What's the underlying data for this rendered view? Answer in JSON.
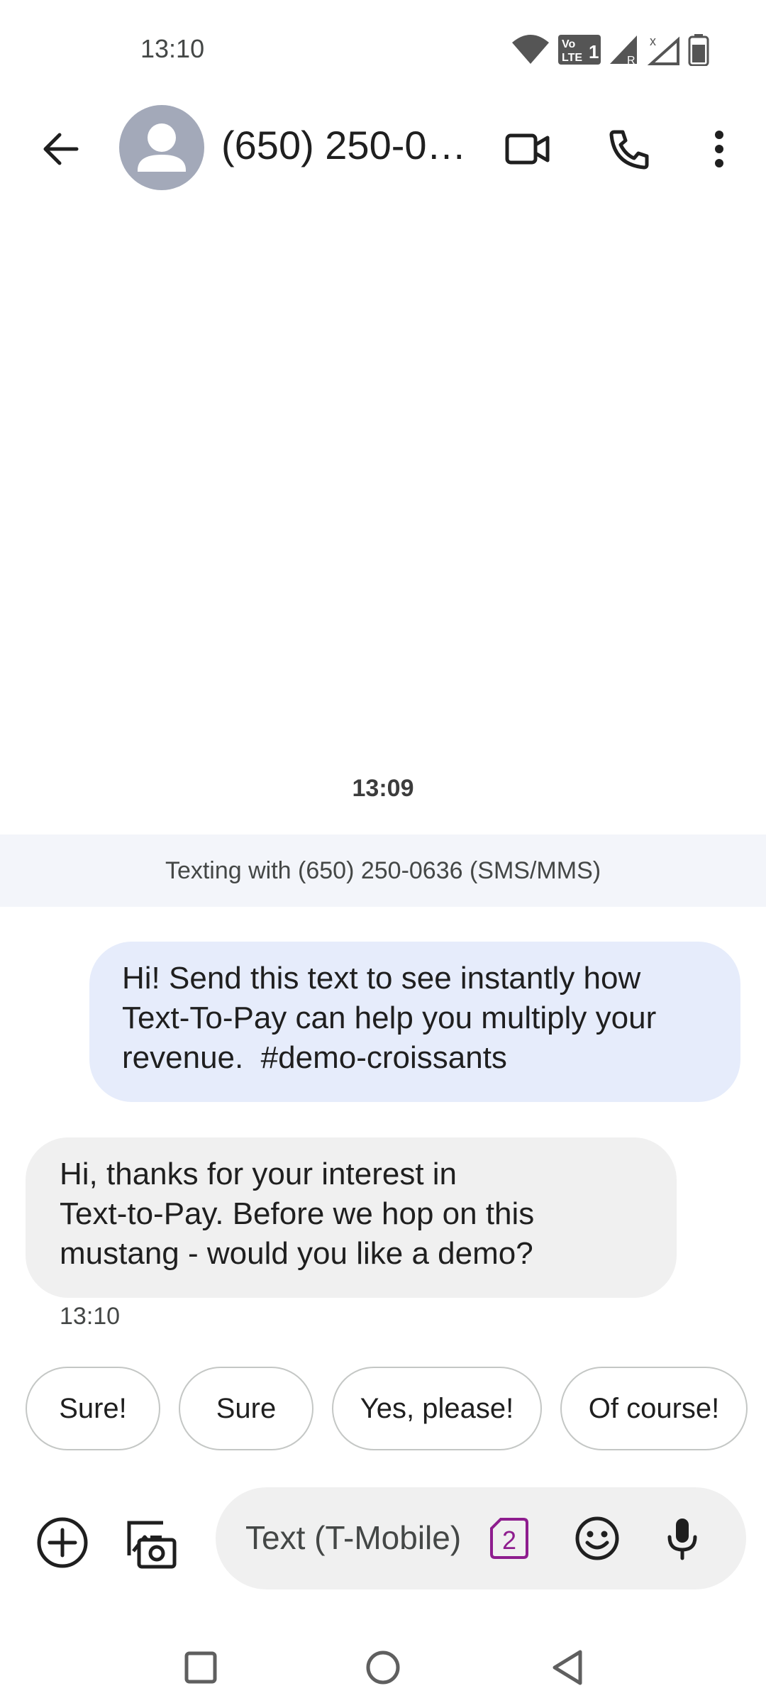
{
  "status_bar": {
    "time": "13:10",
    "icons": [
      "wifi-icon",
      "volte-icon",
      "signal-roaming-icon",
      "signal-no-service-icon",
      "battery-icon"
    ],
    "volte_text": "Vo LTE 1"
  },
  "app_bar": {
    "contact_name": "(650) 250-0636",
    "icons": [
      "back-arrow-icon",
      "avatar-person-icon",
      "video-call-icon",
      "phone-icon",
      "more-vert-icon"
    ]
  },
  "conversation": {
    "time_divider": "13:09",
    "banner": "Texting with (650) 250-0636 (SMS/MMS)",
    "messages": [
      {
        "direction": "outgoing",
        "lines": [
          "Hi! Send this text to see instantly how",
          "Text-To-Pay can help you multiply your",
          "revenue.  #demo-croissants"
        ]
      },
      {
        "direction": "incoming",
        "lines": [
          "Hi, thanks for your interest in",
          "Text-to-Pay. Before we hop on this",
          "mustang - would you like a demo?"
        ],
        "time": "13:10"
      }
    ]
  },
  "suggestions": [
    "Sure!",
    "Sure",
    "Yes, please!",
    "Of course!"
  ],
  "compose": {
    "placeholder": "Text (T-Mobile)",
    "sim_number": "2",
    "icons": [
      "add-circle-icon",
      "gallery-camera-icon",
      "sim-icon",
      "emoji-icon",
      "mic-icon"
    ]
  },
  "colors": {
    "outgoing_bubble": "#e6ecfb",
    "incoming_bubble": "#f0f0f0",
    "banner_bg": "#f3f5fa",
    "avatar_bg": "#a3a9b9",
    "sim_accent": "#8e1d8e"
  },
  "nav_bar": {
    "icons": [
      "recents-square-icon",
      "home-circle-icon",
      "back-triangle-icon"
    ]
  }
}
